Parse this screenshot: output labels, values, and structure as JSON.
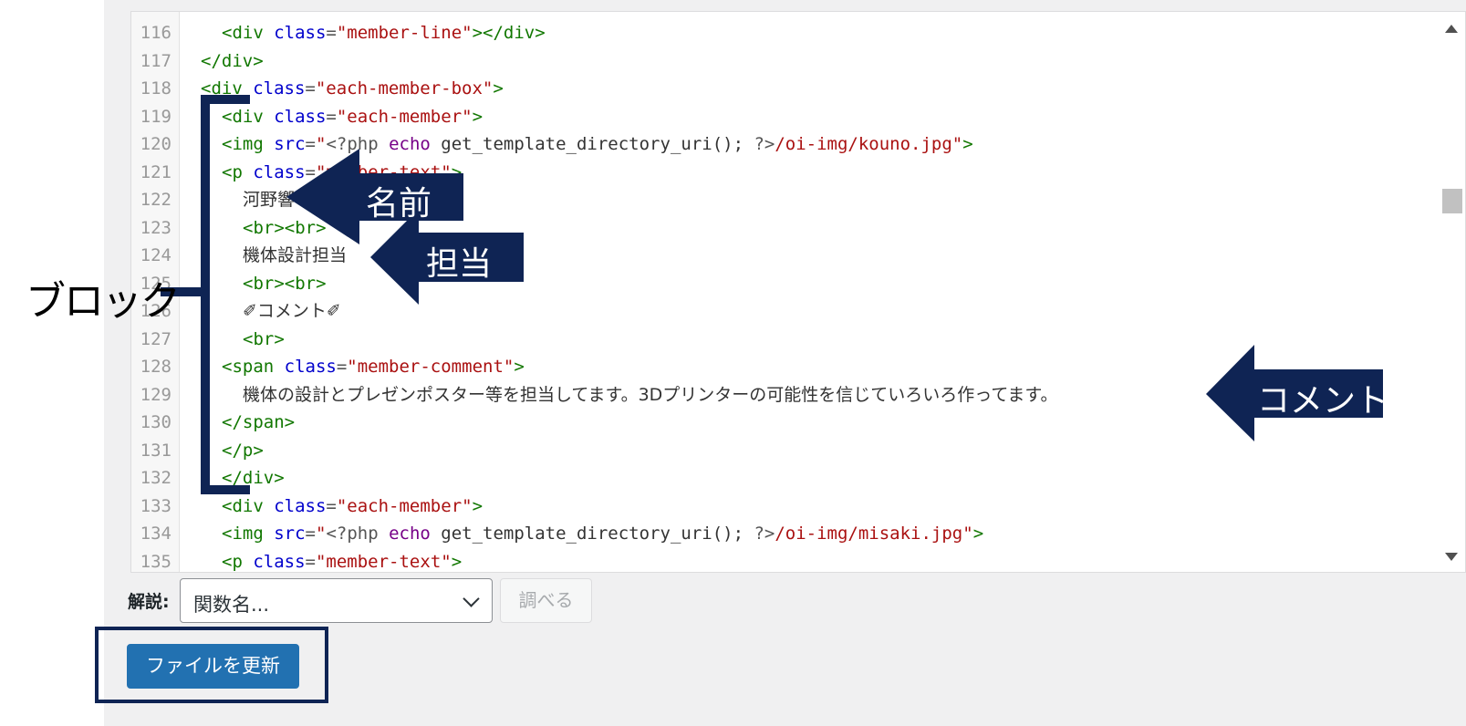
{
  "editor": {
    "lines": [
      {
        "num": "116",
        "indent": 2,
        "tokens": [
          [
            "t",
            "<div "
          ],
          [
            "a",
            "class"
          ],
          [
            "m",
            "="
          ],
          [
            "s",
            "\"member-line\""
          ],
          [
            "t",
            "></div>"
          ]
        ]
      },
      {
        "num": "117",
        "indent": 1,
        "tokens": [
          [
            "t",
            "</div>"
          ]
        ]
      },
      {
        "num": "118",
        "indent": 1,
        "tokens": [
          [
            "t",
            "<div "
          ],
          [
            "a",
            "class"
          ],
          [
            "m",
            "="
          ],
          [
            "s",
            "\"each-member-box\""
          ],
          [
            "t",
            ">"
          ]
        ]
      },
      {
        "num": "119",
        "indent": 2,
        "tokens": [
          [
            "t",
            "<div "
          ],
          [
            "a",
            "class"
          ],
          [
            "m",
            "="
          ],
          [
            "s",
            "\"each-member\""
          ],
          [
            "t",
            ">"
          ]
        ]
      },
      {
        "num": "120",
        "indent": 2,
        "tokens": [
          [
            "t",
            "<img "
          ],
          [
            "a",
            "src"
          ],
          [
            "m",
            "="
          ],
          [
            "s",
            "\""
          ],
          [
            "m",
            "<?php "
          ],
          [
            "k",
            "echo"
          ],
          [
            "p",
            " get_template_directory_uri(); "
          ],
          [
            "m",
            "?>"
          ],
          [
            "s",
            "/oi-img/kouno.jpg\""
          ],
          [
            "t",
            ">"
          ]
        ]
      },
      {
        "num": "121",
        "indent": 2,
        "tokens": [
          [
            "t",
            "<p "
          ],
          [
            "a",
            "class"
          ],
          [
            "m",
            "="
          ],
          [
            "s",
            "\"member-text\""
          ],
          [
            "t",
            ">"
          ]
        ]
      },
      {
        "num": "122",
        "indent": 3,
        "tokens": [
          [
            "j",
            "河野響"
          ]
        ]
      },
      {
        "num": "123",
        "indent": 3,
        "tokens": [
          [
            "t",
            "<br><br>"
          ]
        ]
      },
      {
        "num": "124",
        "indent": 3,
        "tokens": [
          [
            "j",
            "機体設計担当"
          ]
        ]
      },
      {
        "num": "125",
        "indent": 3,
        "tokens": [
          [
            "t",
            "<br><br>"
          ]
        ]
      },
      {
        "num": "126",
        "indent": 3,
        "tokens": [
          [
            "j",
            "✐コメント✐"
          ]
        ]
      },
      {
        "num": "127",
        "indent": 3,
        "tokens": [
          [
            "t",
            "<br>"
          ]
        ]
      },
      {
        "num": "128",
        "indent": 2,
        "tokens": [
          [
            "t",
            "<span "
          ],
          [
            "a",
            "class"
          ],
          [
            "m",
            "="
          ],
          [
            "s",
            "\"member-comment\""
          ],
          [
            "t",
            ">"
          ]
        ]
      },
      {
        "num": "129",
        "indent": 3,
        "tokens": [
          [
            "j",
            "機体の設計とプレゼンポスター等を担当してます。3Dプリンターの可能性を信じていろいろ作ってます。"
          ]
        ]
      },
      {
        "num": "130",
        "indent": 2,
        "tokens": [
          [
            "t",
            "</span>"
          ]
        ]
      },
      {
        "num": "131",
        "indent": 2,
        "tokens": [
          [
            "t",
            "</p>"
          ]
        ]
      },
      {
        "num": "132",
        "indent": 2,
        "tokens": [
          [
            "t",
            "</div>"
          ]
        ]
      },
      {
        "num": "133",
        "indent": 2,
        "tokens": [
          [
            "t",
            "<div "
          ],
          [
            "a",
            "class"
          ],
          [
            "m",
            "="
          ],
          [
            "s",
            "\"each-member\""
          ],
          [
            "t",
            ">"
          ]
        ]
      },
      {
        "num": "134",
        "indent": 2,
        "tokens": [
          [
            "t",
            "<img "
          ],
          [
            "a",
            "src"
          ],
          [
            "m",
            "="
          ],
          [
            "s",
            "\""
          ],
          [
            "m",
            "<?php "
          ],
          [
            "k",
            "echo"
          ],
          [
            "p",
            " get_template_directory_uri(); "
          ],
          [
            "m",
            "?>"
          ],
          [
            "s",
            "/oi-img/misaki.jpg\""
          ],
          [
            "t",
            ">"
          ]
        ]
      },
      {
        "num": "135",
        "indent": 2,
        "tokens": [
          [
            "t",
            "<p "
          ],
          [
            "a",
            "class"
          ],
          [
            "m",
            "="
          ],
          [
            "s",
            "\"member-text\""
          ],
          [
            "t",
            ">"
          ]
        ]
      }
    ]
  },
  "controls": {
    "doc_label": "解説:",
    "function_select_value": "関数名...",
    "lookup_label": "調べる",
    "update_label": "ファイルを更新"
  },
  "annotations": {
    "block": "ブロック",
    "name": "名前",
    "role": "担当",
    "comment": "コメント",
    "color": "#0f2454"
  },
  "colors": {
    "tag": "#117700",
    "attribute": "#0000cc",
    "string": "#aa1111",
    "keyword": "#770088",
    "primary_button": "#2271b1"
  }
}
